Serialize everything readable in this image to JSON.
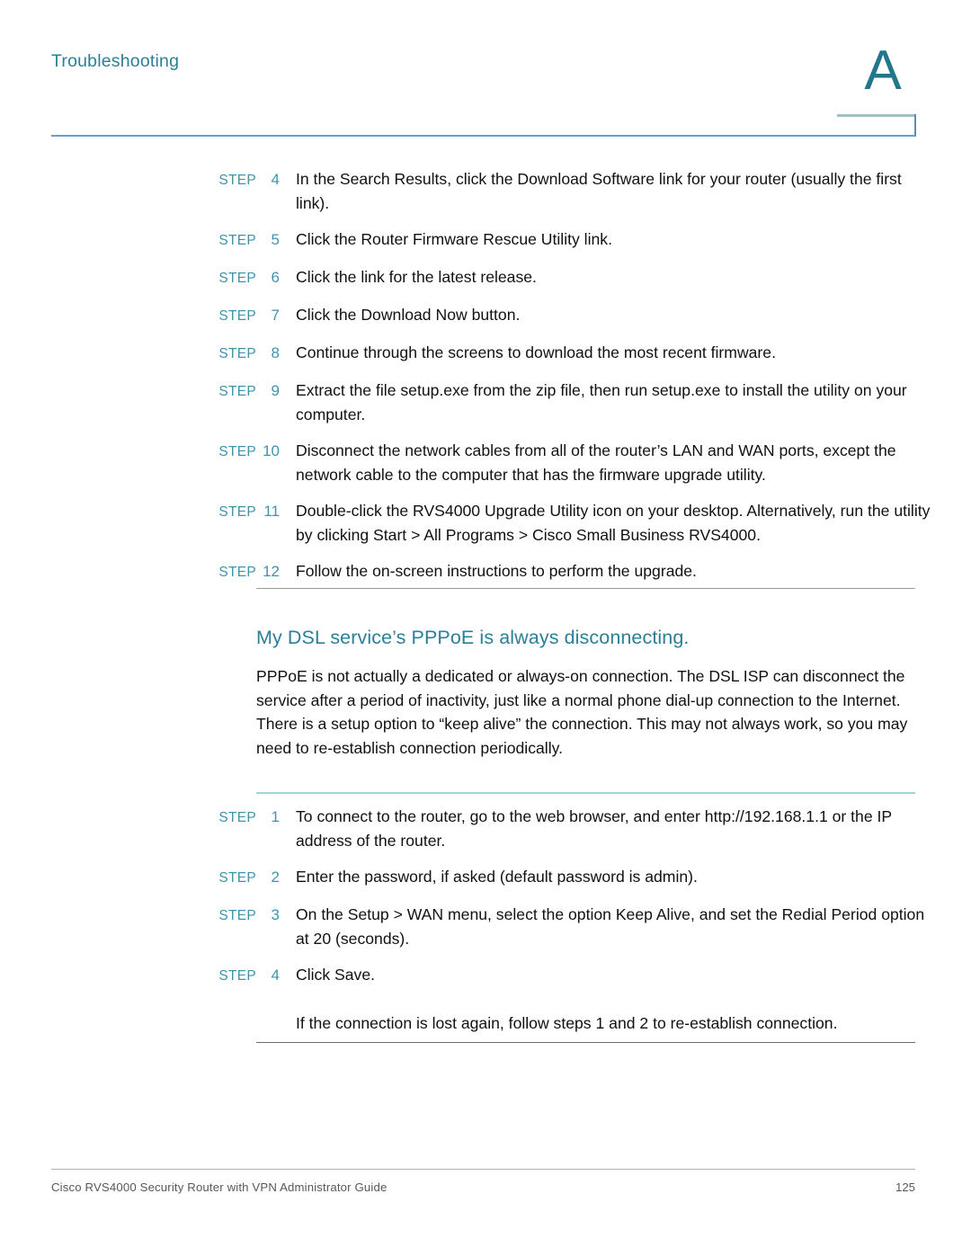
{
  "header": {
    "chapter_label": "Troubleshooting",
    "chapter_letter": "A",
    "accent_color": "#2b7f96"
  },
  "steps_group_1": [
    {
      "label": "STEP",
      "number": "4",
      "text": "In the Search Results, click the Download Software link for your router (usually the first link)."
    },
    {
      "label": "STEP",
      "number": "5",
      "text": "Click the Router Firmware Rescue Utility link."
    },
    {
      "label": "STEP",
      "number": "6",
      "text": "Click the link for the latest release."
    },
    {
      "label": "STEP",
      "number": "7",
      "text": "Click the Download Now button."
    },
    {
      "label": "STEP",
      "number": "8",
      "text": "Continue through the screens to download the most recent firmware."
    },
    {
      "label": "STEP",
      "number": "9",
      "text": "Extract the file setup.exe from the zip file, then run setup.exe to install the utility on your computer."
    },
    {
      "label": "STEP",
      "number": "10",
      "text": "Disconnect the network cables from all of the router’s LAN and WAN ports, except the network cable to the computer that has the firmware upgrade utility."
    },
    {
      "label": "STEP",
      "number": "11",
      "text": "Double-click the RVS4000 Upgrade Utility icon on your desktop. Alternatively, run the utility by clicking Start > All Programs > Cisco Small Business RVS4000."
    },
    {
      "label": "STEP",
      "number": "12",
      "text": "Follow the on-screen instructions to perform the upgrade."
    }
  ],
  "section": {
    "heading": "My DSL service’s PPPoE is always disconnecting.",
    "paragraph": "PPPoE is not actually a dedicated or always-on connection. The DSL ISP can disconnect the service after a period of inactivity, just like a normal phone dial-up connection to the Internet. There is a setup option to “keep alive” the connection. This may not always work, so you may need to re-establish connection periodically."
  },
  "steps_group_2": [
    {
      "label": "STEP",
      "number": "1",
      "text": "To connect to the router, go to the web browser, and enter http://192.168.1.1 or the IP address of the router."
    },
    {
      "label": "STEP",
      "number": "2",
      "text": "Enter the password, if asked (default password is admin)."
    },
    {
      "label": "STEP",
      "number": "3",
      "text": "On the Setup > WAN menu, select the option Keep Alive, and set the Redial Period option at 20 (seconds)."
    },
    {
      "label": "STEP",
      "number": "4",
      "text": "Click Save."
    }
  ],
  "closing_note": "If the connection is lost again, follow steps 1 and 2 to re-establish connection.",
  "footer": {
    "left": "Cisco RVS4000 Security Router with VPN Administrator Guide",
    "page_number": "125"
  }
}
